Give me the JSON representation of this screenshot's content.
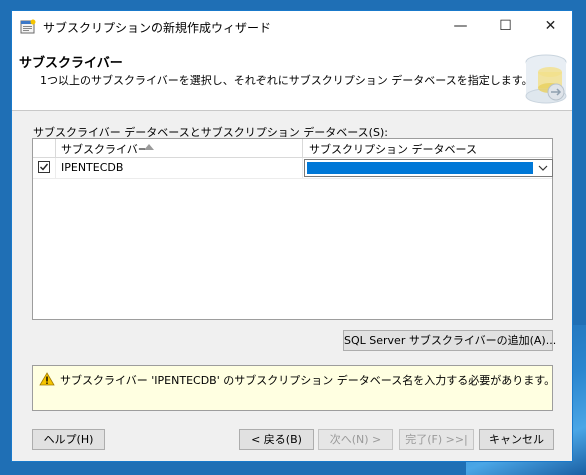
{
  "window": {
    "title": "サブスクリプションの新規作成ウィザード",
    "controls": {
      "minimize_icon": "minimize-icon",
      "maximize_icon": "maximize-icon",
      "close_icon": "close-icon"
    }
  },
  "header": {
    "title": "サブスクライバー",
    "description": "1つ以上のサブスクライバーを選択し、それぞれにサブスクリプション データベースを指定します。"
  },
  "subscribers": {
    "section_label": "サブスクライバー データベースとサブスクリプション データベース(S):",
    "columns": [
      "サブスクライバー",
      "サブスクリプション データベース"
    ],
    "rows": [
      {
        "checked": true,
        "name": "IPENTECDB",
        "database": ""
      }
    ],
    "add_button": "SQL Server サブスクライバーの追加(A)..."
  },
  "message": {
    "icon": "warning-icon",
    "text": "サブスクライバー 'IPENTECDB' のサブスクリプション データベース名を入力する必要があります。"
  },
  "footer": {
    "help": "ヘルプ(H)",
    "back": "< 戻る(B)",
    "next": "次へ(N) >",
    "finish": "完了(F) >>|",
    "cancel": "キャンセル"
  },
  "colors": {
    "accent": "#0078d7",
    "warning_background": "#ffffe1",
    "window_border": "#1979ca"
  }
}
